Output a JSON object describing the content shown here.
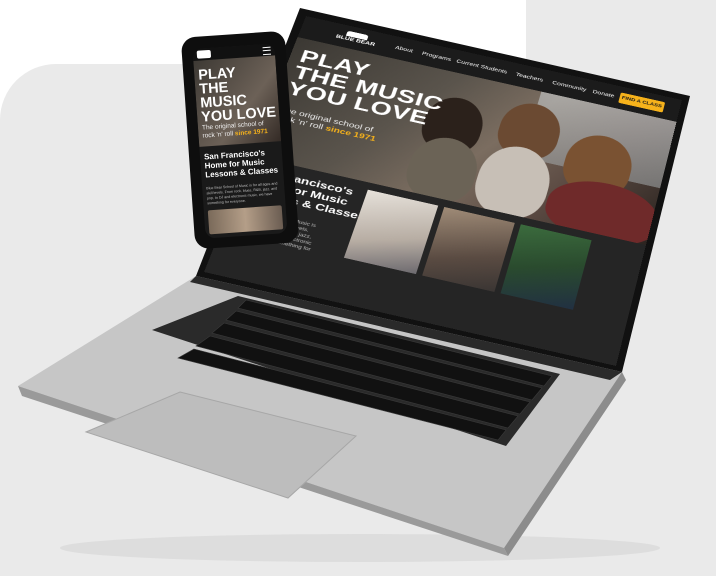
{
  "site": {
    "logo_text": "BLUE BEAR",
    "logo_sub": "SCHOOL OF MUSIC"
  },
  "nav": {
    "items": [
      "About",
      "Programs",
      "Current Students",
      "Teachers",
      "Community",
      "Donate"
    ],
    "cta_label": "FIND A CLASS"
  },
  "hero": {
    "line1": "PLAY",
    "line2": "THE MUSIC",
    "line3": "YOU LOVE",
    "sub_line1": "The original school of",
    "sub_line2_prefix": "rock 'n' roll ",
    "sub_line2_highlight": "since 1971"
  },
  "section": {
    "heading_line1": "San Francisco's",
    "heading_line2": "Home for Music",
    "heading_line3": "Lessons & Classes",
    "body": "Blue Bear School of Music is for all ages and skill levels. From rock, blues, R&B, jazz, and pop, to DJ and electronic music, we have something for everyone."
  },
  "colors": {
    "accent": "#f6b21b",
    "page_dark": "#141414",
    "background_panel": "#eaeaea"
  }
}
